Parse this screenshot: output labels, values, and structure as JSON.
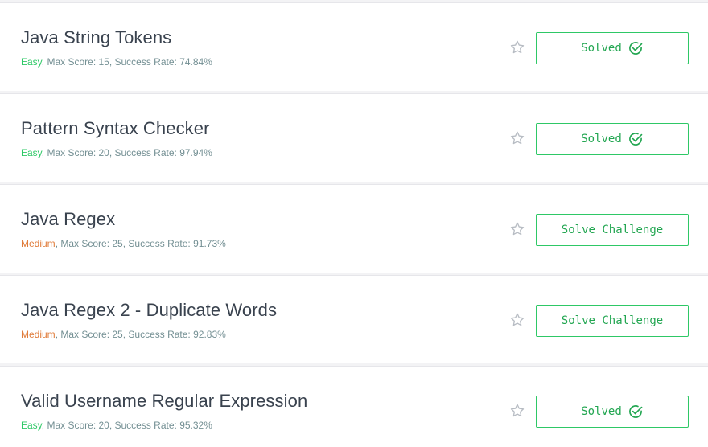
{
  "challenges": [
    {
      "title": "Java String Tokens",
      "difficulty": "Easy",
      "meta_rest": ", Max Score: 15, Success Rate: 74.84%",
      "button": "Solved",
      "solved": true
    },
    {
      "title": "Pattern Syntax Checker",
      "difficulty": "Easy",
      "meta_rest": ", Max Score: 20, Success Rate: 97.94%",
      "button": "Solved",
      "solved": true
    },
    {
      "title": "Java Regex",
      "difficulty": "Medium",
      "meta_rest": ", Max Score: 25, Success Rate: 91.73%",
      "button": "Solve Challenge",
      "solved": false
    },
    {
      "title": "Java Regex 2 - Duplicate Words",
      "difficulty": "Medium",
      "meta_rest": ", Max Score: 25, Success Rate: 92.83%",
      "button": "Solve Challenge",
      "solved": false
    },
    {
      "title": "Valid Username Regular Expression",
      "difficulty": "Easy",
      "meta_rest": ", Max Score: 20, Success Rate: 95.32%",
      "button": "Solved",
      "solved": true
    }
  ],
  "icons": {
    "star": "star-outline-icon",
    "solved": "check-circle-icon"
  },
  "colors": {
    "easy": "#2ec866",
    "medium": "#e07b39",
    "button_border": "#2ec866",
    "button_text": "#22a651",
    "title": "#39424e",
    "meta": "#738f93",
    "star": "#b7bcc3"
  }
}
